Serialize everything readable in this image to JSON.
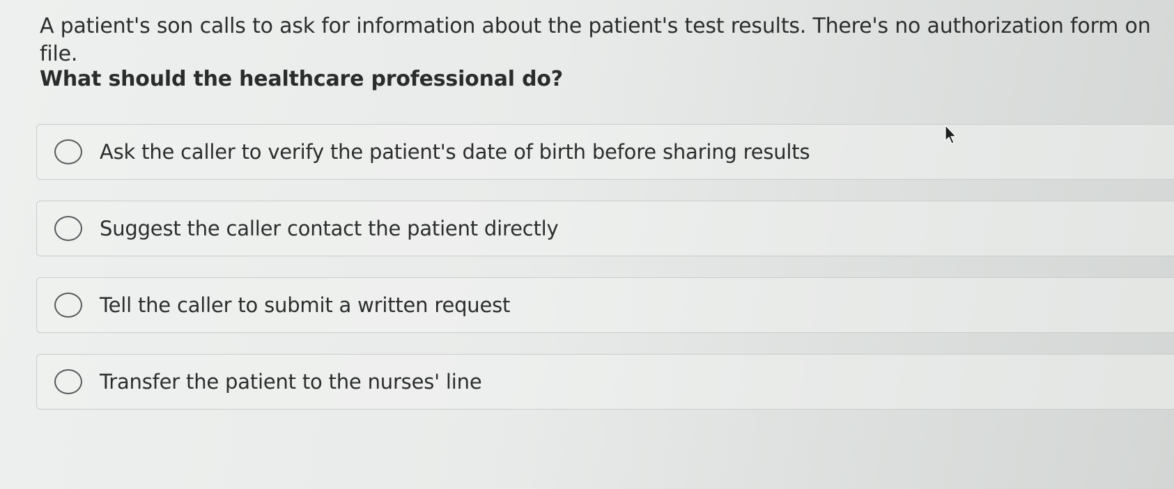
{
  "question": {
    "text": "A patient's son calls to ask for information about the patient's test results. There's no authorization form on file.",
    "prompt": "What should the healthcare professional do?"
  },
  "options": [
    {
      "label": "Ask the caller to verify the patient's date of birth before sharing results",
      "selected": false
    },
    {
      "label": "Suggest the caller contact the patient directly",
      "selected": false
    },
    {
      "label": "Tell the caller to submit a written request",
      "selected": false
    },
    {
      "label": "Transfer the patient to the nurses' line",
      "selected": false
    }
  ],
  "cursor": {
    "icon": "mouse-pointer-icon"
  }
}
